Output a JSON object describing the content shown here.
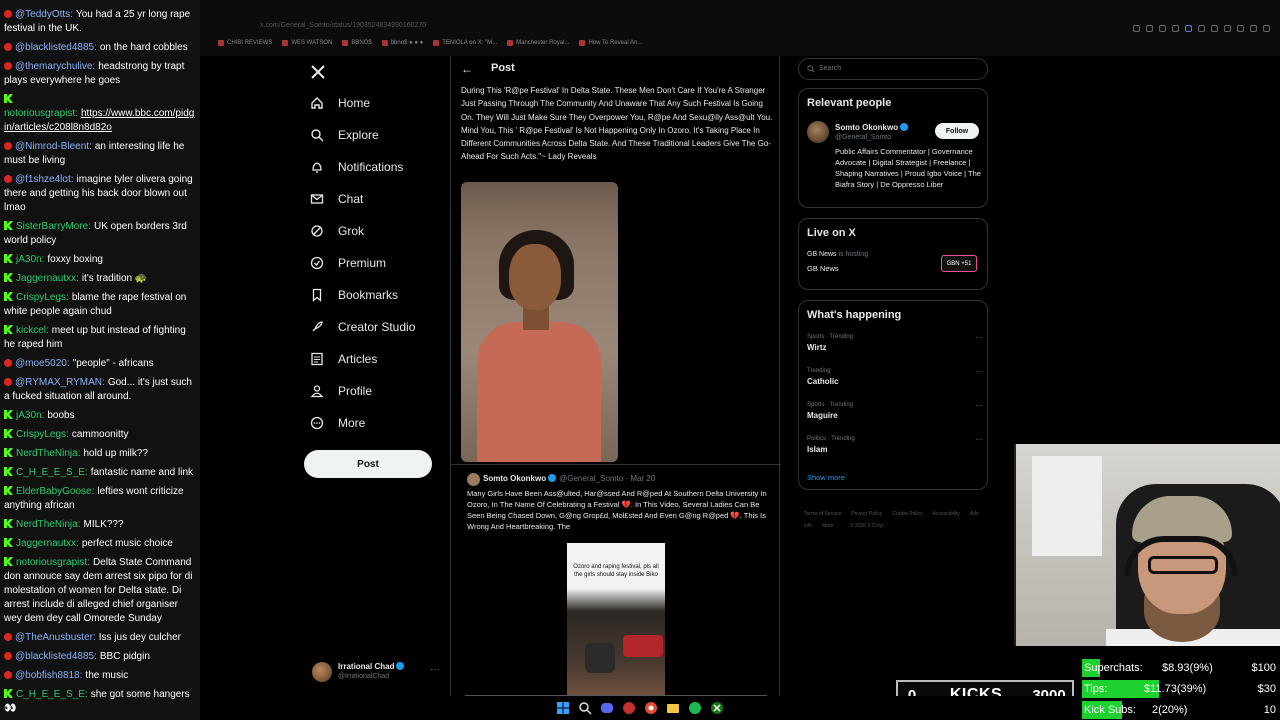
{
  "chat": {
    "messages": [
      {
        "platform": "yt",
        "user": "@TeddyOtts:",
        "text": "You had a 25 yr long rape festival in the UK."
      },
      {
        "platform": "yt",
        "user": "@blacklisted4885:",
        "text": "on the hard cobbles"
      },
      {
        "platform": "yt",
        "user": "@themarychulive:",
        "text": "headstrong by trapt plays everywhere he goes"
      },
      {
        "platform": "kick",
        "user": "notoriousgrapist:",
        "text": "https://www.bbc.com/pidgin/articles/c208l8n8d82o",
        "link": true
      },
      {
        "platform": "yt",
        "user": "@Nimrod-Bleent:",
        "text": "an interesting life he must be living"
      },
      {
        "platform": "yt",
        "user": "@f1shze4lot:",
        "text": "imagine tyler olivera going there and getting his back door blown out lmao"
      },
      {
        "platform": "kick",
        "user": "SisterBarryMore:",
        "text": "UK open borders 3rd world policy"
      },
      {
        "platform": "kick",
        "user": "jA30n:",
        "text": "foxxy boxing"
      },
      {
        "platform": "kick",
        "user": "Jaggernautxx:",
        "text": "it's tradition 🐢"
      },
      {
        "platform": "kick",
        "user": "CrispyLegs:",
        "text": "blame the rape festival on white people again chud"
      },
      {
        "platform": "kick",
        "user": "kickcel:",
        "text": "meet up but instead of fighting he raped him"
      },
      {
        "platform": "yt",
        "user": "@moe5020:",
        "text": "\"people\" - africans"
      },
      {
        "platform": "yt",
        "user": "@RYMAX_RYMAN:",
        "text": "God... it's just such a fucked situation all around."
      },
      {
        "platform": "kick",
        "user": "jA30n:",
        "text": "boobs"
      },
      {
        "platform": "kick",
        "user": "CrispyLegs:",
        "text": "cammoonitty"
      },
      {
        "platform": "kick",
        "user": "NerdTheNinja:",
        "text": "hold up milk??"
      },
      {
        "platform": "kick",
        "user": "C_H_E_E_S_E:",
        "text": "fantastic name and link"
      },
      {
        "platform": "kick",
        "user": "ElderBabyGoose:",
        "text": "lefties wont criticize anything african"
      },
      {
        "platform": "kick",
        "user": "NerdTheNinja:",
        "text": "MILK???"
      },
      {
        "platform": "kick",
        "user": "Jaggernautxx:",
        "text": "perfect music choice"
      },
      {
        "platform": "kick",
        "user": "notoriousgrapist:",
        "text": "Delta State Command don annouce say dem arrest six pipo for di molestation of women for Delta state. Di arrest include di alleged chief organiser wey dem dey call Omorede Sunday"
      },
      {
        "platform": "yt",
        "user": "@TheAnusbuster:",
        "text": "Iss jus dey culcher"
      },
      {
        "platform": "yt",
        "user": "@blacklisted4885:",
        "text": "BBC pidgin"
      },
      {
        "platform": "yt",
        "user": "@bobfish8818:",
        "text": "the music"
      },
      {
        "platform": "kick",
        "user": "C_H_E_E_S_E:",
        "text": "she got some hangers 👀"
      }
    ]
  },
  "browser": {
    "url": "x.com/General_Somto/status/1903524834990160270",
    "bookmarks": [
      "CHIBI REVIEWS",
      "WES WATSON",
      "BBNO$",
      "bbno$ ● ● ●",
      "TENIOLA on X: \"M...",
      "Manchester Royal...",
      "How To Reveal An..."
    ]
  },
  "x_nav": {
    "items": [
      {
        "label": "Home",
        "icon": "home-icon"
      },
      {
        "label": "Explore",
        "icon": "search-icon"
      },
      {
        "label": "Notifications",
        "icon": "bell-icon"
      },
      {
        "label": "Chat",
        "icon": "mail-icon"
      },
      {
        "label": "Grok",
        "icon": "grok-icon"
      },
      {
        "label": "Premium",
        "icon": "premium-icon"
      },
      {
        "label": "Bookmarks",
        "icon": "bookmark-icon"
      },
      {
        "label": "Creator Studio",
        "icon": "rocket-icon"
      },
      {
        "label": "Articles",
        "icon": "articles-icon"
      },
      {
        "label": "Profile",
        "icon": "person-icon"
      },
      {
        "label": "More",
        "icon": "more-circle-icon"
      }
    ],
    "post_label": "Post",
    "account": {
      "name": "Irrational Chad",
      "handle": "@IrrationalChad"
    }
  },
  "main": {
    "title": "Post",
    "tweet_text": "During This 'R@pe Festival' In Delta State. These Men Don't Care If You're A Stranger Just Passing Through The Community And Unaware That Any Such Festival Is Going On. They Will Just Make Sure They Overpower You, R@pe And Sexu@lly Ass@ult You. Mind You, This ' R@pe Festival' Is Not Happening Only In Ozoro. It's Taking Place In Different Communities Across Delta State. And These Traditional Leaders Give The Go-Ahead For Such Acts.\"~ Lady Reveals",
    "quoted": {
      "name": "Somto Okonkwo",
      "handle": "@General_Somto · Mar 20",
      "text": "Many Girls Have Been Ass@ulted, Har@ssed And R@ped At Southern Delta University In Ozoro, In The Name Of Celebrating a Festival 💔. In This Video, Several Ladies Can Be Seen Being Chased Down, G@ng Grop£d, Mol£sted And Even G@ng R@ped 💔. This Is Wrong And Heartbreaking. The",
      "video_caption": "Ozoro and raping festival, pls all the girls should stay inside Biko"
    }
  },
  "right": {
    "search_placeholder": "Search",
    "relevant_title": "Relevant people",
    "person": {
      "name": "Somto Okonkwo",
      "handle": "@General_Somto",
      "bio": "Public Affairs Commentator | Governance Advocate | Digital Strategist | Freelance | Shaping Narratives | Proud Igbo Voice | The Biafra Story | De Oppresso Liber",
      "follow_label": "Follow"
    },
    "live_title": "Live on X",
    "live": {
      "source": "GB News",
      "hosting": "is hosting",
      "title": "GB News",
      "badge": "GBN +51"
    },
    "happening_title": "What's happening",
    "trends": [
      {
        "context": "Sports · Trending",
        "name": "Wirtz"
      },
      {
        "context": "Trending",
        "name": "Catholic"
      },
      {
        "context": "Sports · Trending",
        "name": "Maguire"
      },
      {
        "context": "Politics · Trending",
        "name": "Islam"
      }
    ],
    "show_more": "Show more",
    "footer": [
      "Terms of Service",
      "Privacy Policy",
      "Cookie Policy",
      "Accessibility",
      "Ads info",
      "More ···",
      "© 2026 X Corp."
    ]
  },
  "overlay": {
    "kicks": {
      "current": "0",
      "label": "KICKS",
      "goal": "3000",
      "progress": 0
    },
    "goals": [
      {
        "label": "Superchats:",
        "value": "$8.93(9%)",
        "target": "$100",
        "progress": 0.09
      },
      {
        "label": "Tips:",
        "value": "$11.73(39%)",
        "target": "$30",
        "progress": 0.39
      },
      {
        "label": "Kick Subs:",
        "value": "2(20%)",
        "target": "10",
        "progress": 0.2
      }
    ]
  },
  "colors": {
    "accent": "#1d9bf0",
    "kick_green": "#53fc18",
    "goal_green": "#1dd12f",
    "yt_red": "#e02424",
    "bg": "#000000"
  }
}
